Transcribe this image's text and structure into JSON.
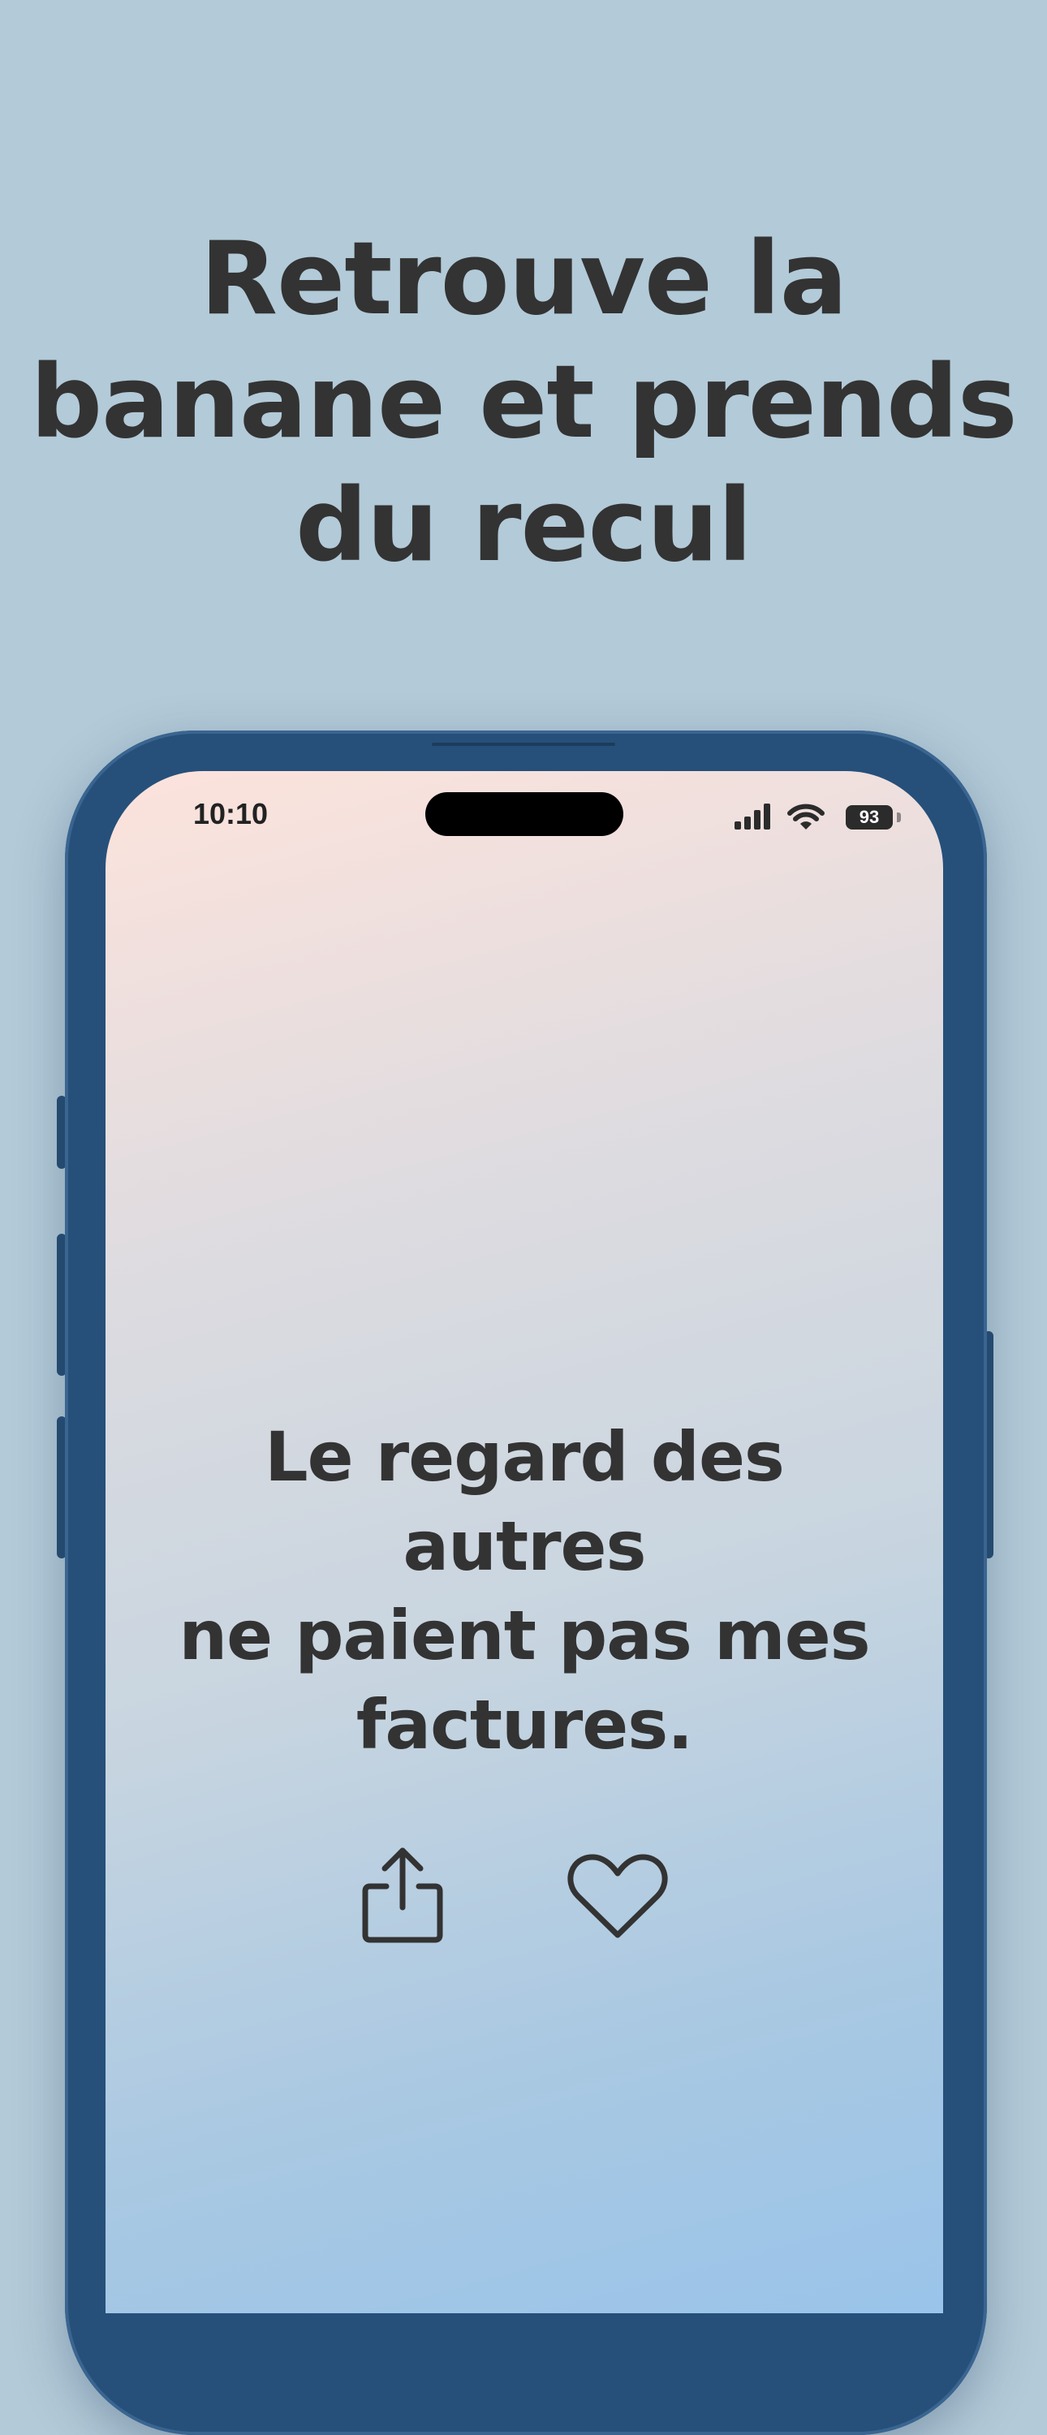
{
  "headline": {
    "line1": "Retrouve la",
    "line2": "banane et prends",
    "line3": "du recul"
  },
  "status_bar": {
    "time": "10:10",
    "battery": "93",
    "icons": [
      "signal-icon",
      "wifi-icon",
      "battery-icon"
    ]
  },
  "quote": {
    "line1": "Le regard des autres",
    "line2": "ne paient pas mes",
    "line3": "factures."
  },
  "actions": {
    "share_icon": "share-icon",
    "favorite_icon": "heart-icon"
  },
  "colors": {
    "background": "#b3cad8",
    "phone_frame": "#26507a",
    "text": "#333333"
  }
}
